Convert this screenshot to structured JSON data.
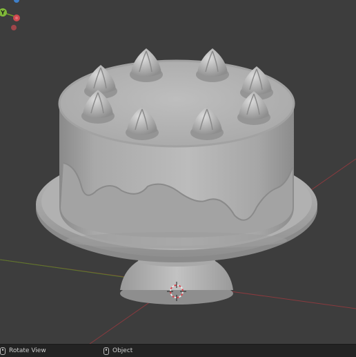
{
  "status_bar": {
    "left_action": "Rotate View",
    "right_action": "Object",
    "left_icon": "mouse-left-icon",
    "right_icon": "mouse-right-icon"
  },
  "gizmo": {
    "y_label": "Y"
  },
  "viewport": {
    "object": "cake-model",
    "colors": {
      "background": "#3d3d3d",
      "x_axis": "#c4414c",
      "y_axis": "#6f9d2c",
      "model": "#b4b4b4"
    }
  }
}
